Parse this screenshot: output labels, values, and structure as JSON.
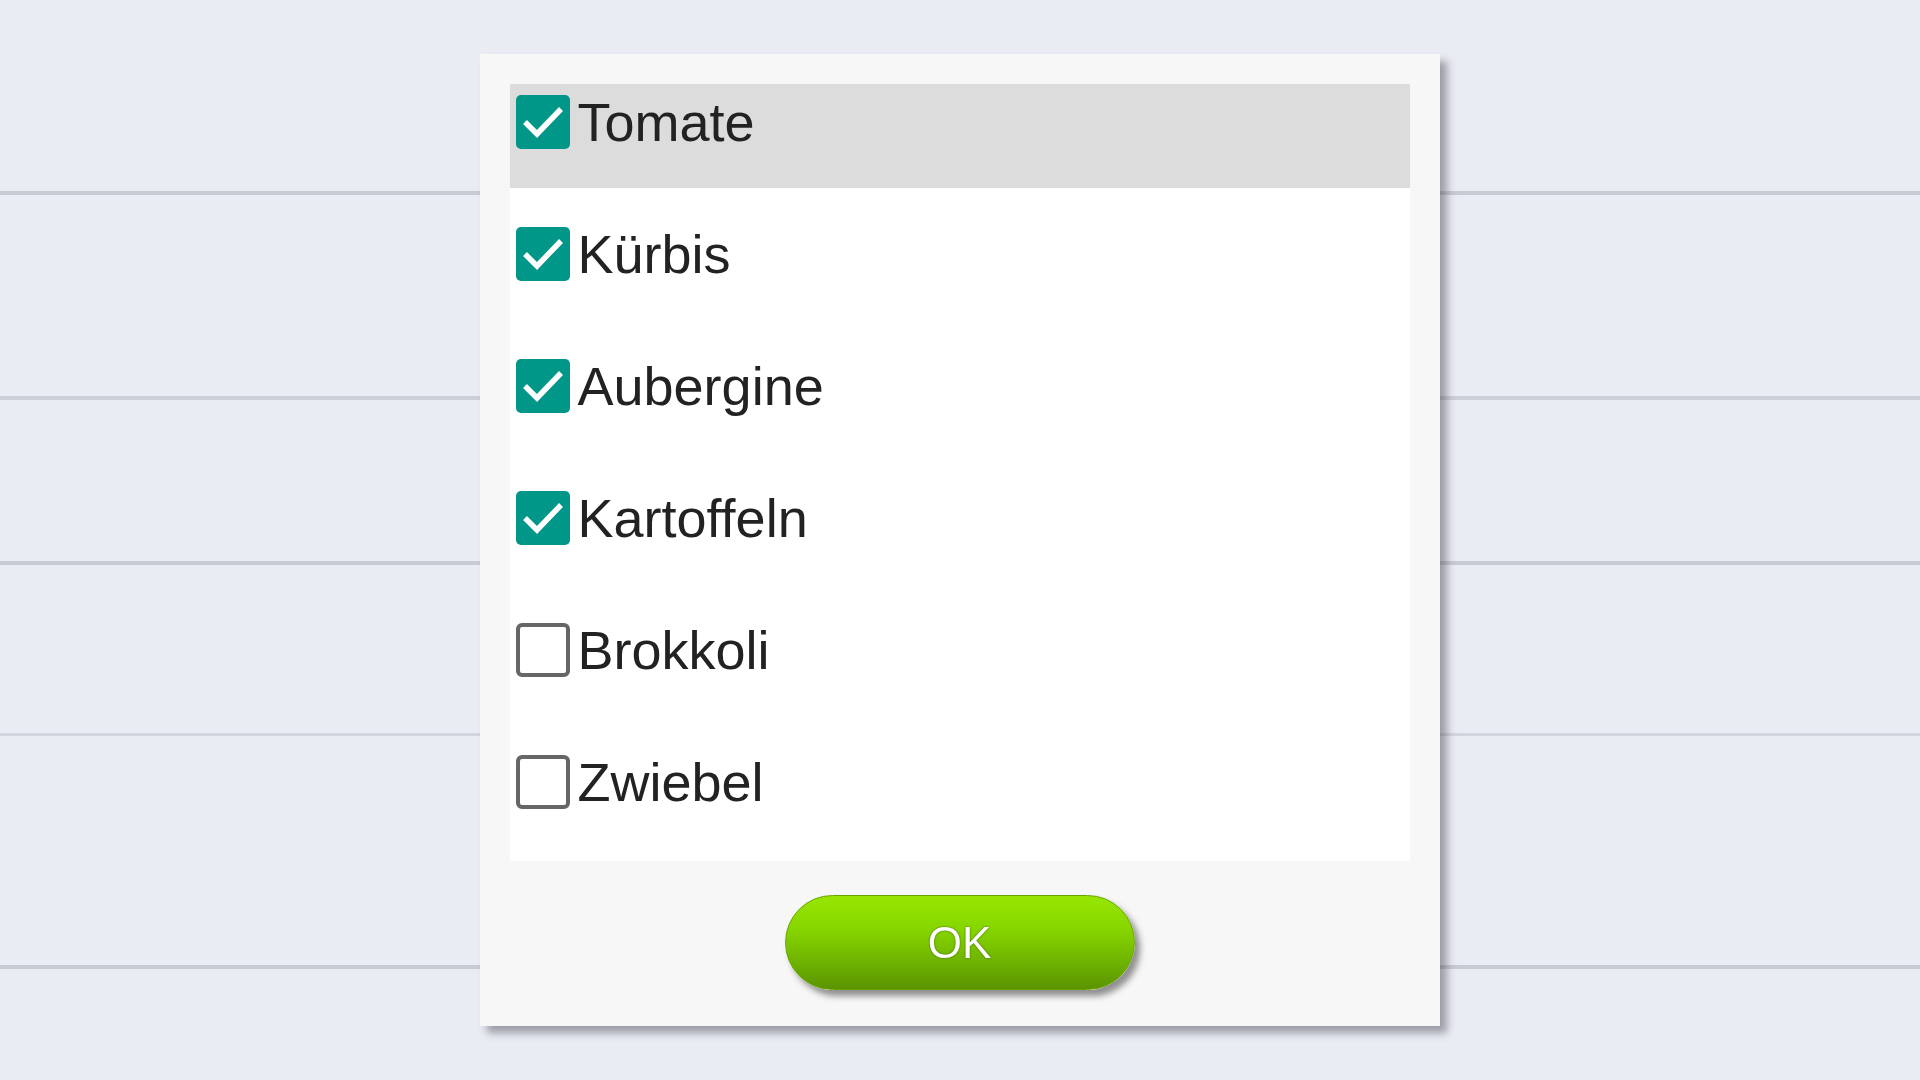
{
  "items": [
    {
      "label": "Tomate",
      "checked": true,
      "selected": true
    },
    {
      "label": "Kürbis",
      "checked": true,
      "selected": false
    },
    {
      "label": "Aubergine",
      "checked": true,
      "selected": false
    },
    {
      "label": "Kartoffeln",
      "checked": true,
      "selected": false
    },
    {
      "label": "Brokkoli",
      "checked": false,
      "selected": false
    },
    {
      "label": "Zwiebel",
      "checked": false,
      "selected": false
    }
  ],
  "button": {
    "label": "OK"
  }
}
